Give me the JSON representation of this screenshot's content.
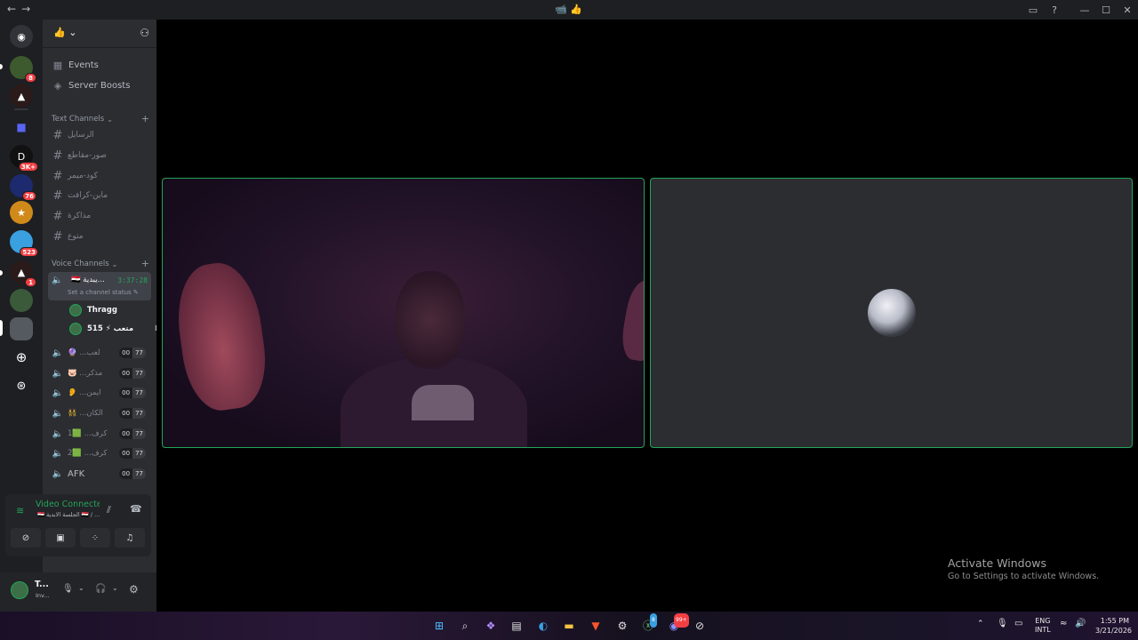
{
  "titlebar": {
    "nav_back": "←",
    "nav_forward": "→",
    "center": "📹 👍",
    "inbox_icon": "inbox-icon",
    "help_icon": "help-icon",
    "minimize": "—",
    "maximize": "☐",
    "close": "✕"
  },
  "rail": {
    "badges": [
      "8",
      "3K+",
      "76",
      "523",
      "1"
    ]
  },
  "server_header": {
    "name": "👍",
    "chevron": "⌄",
    "invite_icon": "add-member-icon"
  },
  "nav_items": [
    {
      "label": "Events",
      "icon": "calendar-icon"
    },
    {
      "label": "Server Boosts",
      "icon": "boost-icon"
    }
  ],
  "text_category": {
    "label": "Text Channels",
    "add": "+"
  },
  "text_channels": [
    "الرسايل",
    "صور-مقاطع",
    "كود-ميمر",
    "ماين-كرافت",
    "مذاكرة",
    "متوع"
  ],
  "voice_category": {
    "label": "Voice Channels",
    "add": "+"
  },
  "active_voice": {
    "name": "🇪🇬 يبدية...",
    "timer": "3:37:28",
    "status": "Set a channel status ✎",
    "users": [
      {
        "name": "Thragg"
      },
      {
        "name": "متعب ⚡ 515"
      }
    ]
  },
  "voice_channels": [
    {
      "name": "🔮 ...لعب",
      "a": "00",
      "b": "77"
    },
    {
      "name": "🐷 ...مذكر",
      "a": "00",
      "b": "77"
    },
    {
      "name": "👂 ...ايمن",
      "a": "00",
      "b": "77"
    },
    {
      "name": "👯 ...الكان",
      "a": "00",
      "b": "77"
    },
    {
      "name": "1🟩 ...كرف",
      "a": "00",
      "b": "77"
    },
    {
      "name": "2🟩 ...كرف",
      "a": "00",
      "b": "77"
    },
    {
      "name": "AFK",
      "a": "00",
      "b": "77"
    }
  ],
  "voice_panel": {
    "status": "Video Connected",
    "sub": "🇪🇬 الجلسة الابدية 🇪🇬 / ..."
  },
  "user_panel": {
    "name": "T...",
    "status": "Inv..."
  },
  "watermark": {
    "title": "Activate Windows",
    "sub": "Go to Settings to activate Windows."
  },
  "taskbar": {
    "lang": "ENG",
    "lang2": "INTL",
    "time": "1:55 PM",
    "date": "3/21/2026",
    "xbox_badge": "8",
    "discord_badge": "99+"
  }
}
